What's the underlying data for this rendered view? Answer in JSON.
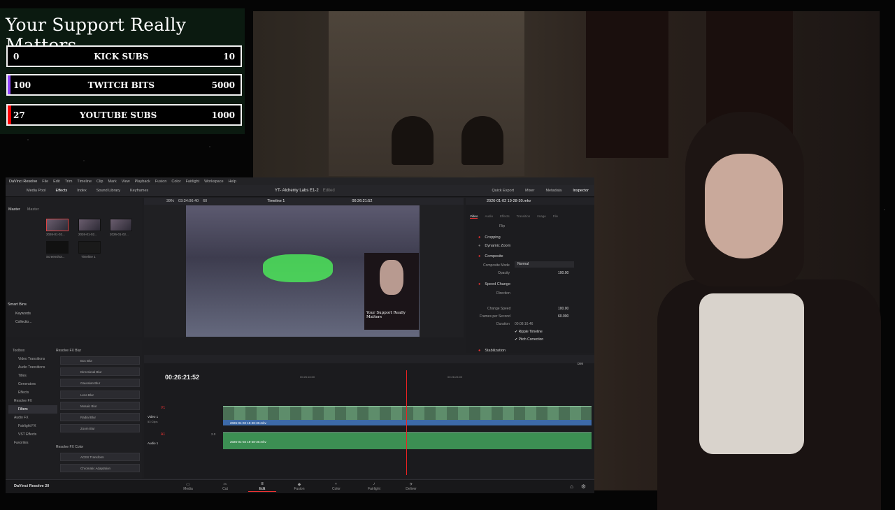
{
  "overlay": {
    "title": "Your Support Really Matters",
    "goals": [
      {
        "label": "KICK SUBS",
        "current": "0",
        "target": "10",
        "color": "#53fc18",
        "progress": 0.0
      },
      {
        "label": "TWITCH BITS",
        "current": "100",
        "target": "5000",
        "color": "#9146ff",
        "progress": 0.02
      },
      {
        "label": "YOUTUBE SUBS",
        "current": "27",
        "target": "1000",
        "color": "#ff0000",
        "progress": 0.027
      }
    ]
  },
  "resolve": {
    "menu": [
      "DaVinci Resolve",
      "File",
      "Edit",
      "Trim",
      "Timeline",
      "Clip",
      "Mark",
      "View",
      "Playback",
      "Fusion",
      "Color",
      "Fairlight",
      "Workspace",
      "Help"
    ],
    "toolbar": {
      "left": [
        "Media Pool",
        "Effects",
        "Index",
        "Sound Library",
        "Keyframes"
      ],
      "project_title": "YT- Alchemy Labs E1-2",
      "edited": "Edited",
      "right": [
        "Quick Export",
        "Mixer",
        "Metadata",
        "Inspector"
      ]
    },
    "media_pool": {
      "tabs": [
        "Master",
        "Master"
      ],
      "clips": [
        "2026-01-02...",
        "2026-01-02...",
        "2026-01-02...",
        "Screenshot...",
        "Timeline 1"
      ],
      "smart_bins_title": "Smart Bins",
      "smart_bins": [
        "Keywords",
        "Collectio..."
      ]
    },
    "viewer_bar": {
      "zoom": "39%",
      "source_tc": "03:34:06:40",
      "fps": "60",
      "timeline": "Timeline 1",
      "record_tc": "00:26:21:52"
    },
    "effects": {
      "tree": [
        "Toolbox",
        "Video Transitions",
        "Audio Transitions",
        "Titles",
        "Generators",
        "Effects",
        "Resolve FX",
        "Filters",
        "Audio FX",
        "Fairlight FX",
        "VST Effects",
        "Favorites"
      ],
      "group1": "Resolve FX Blur",
      "blur_items": [
        "Box Blur",
        "Directional Blur",
        "Gaussian Blur",
        "Lens Blur",
        "Mosaic Blur",
        "Radial Blur",
        "Zoom Blur"
      ],
      "group2": "Resolve FX Color",
      "color_items": [
        "ACES Transform",
        "Chromatic Adaptation"
      ]
    },
    "inspector": {
      "clip": "2026-01-02 19-28-30.mkv",
      "tabs": [
        "Video",
        "Audio",
        "Effects",
        "Transition",
        "Image",
        "File"
      ],
      "flip": "Flip",
      "sections": [
        "Cropping",
        "Dynamic Zoom",
        "Composite",
        "Speed Change",
        "Stabilization"
      ],
      "composite_mode_label": "Composite Mode",
      "composite_mode": "Normal",
      "opacity_label": "Opacity",
      "opacity": "100.00",
      "direction_label": "Direction",
      "change_speed_label": "Change Speed",
      "change_speed": "100.00",
      "fps_label": "Frames per Second",
      "fps_value": "60.000",
      "duration_label": "Duration",
      "duration": "00:08:16:46",
      "ripple": "Ripple Timeline",
      "pitch": "Pitch Correction"
    },
    "timeline": {
      "timecode": "00:26:21:52",
      "ruler": [
        "00:26:16:00",
        "00:26:24:00"
      ],
      "video_track": {
        "id": "V1",
        "name": "Video 1",
        "count": "53 Clips"
      },
      "audio_track": {
        "id": "A1",
        "name": "Audio 1",
        "level": "2.0"
      },
      "video_clip": "2026-01-02 19-28-30.mkv",
      "audio_clip": "2026-01-02 19-28-30.mkv",
      "dim": "DIM"
    },
    "pages": [
      "Media",
      "Cut",
      "Edit",
      "Fusion",
      "Color",
      "Fairlight",
      "Deliver"
    ],
    "active_page": "Edit",
    "brand": "DaVinci Resolve 20"
  }
}
